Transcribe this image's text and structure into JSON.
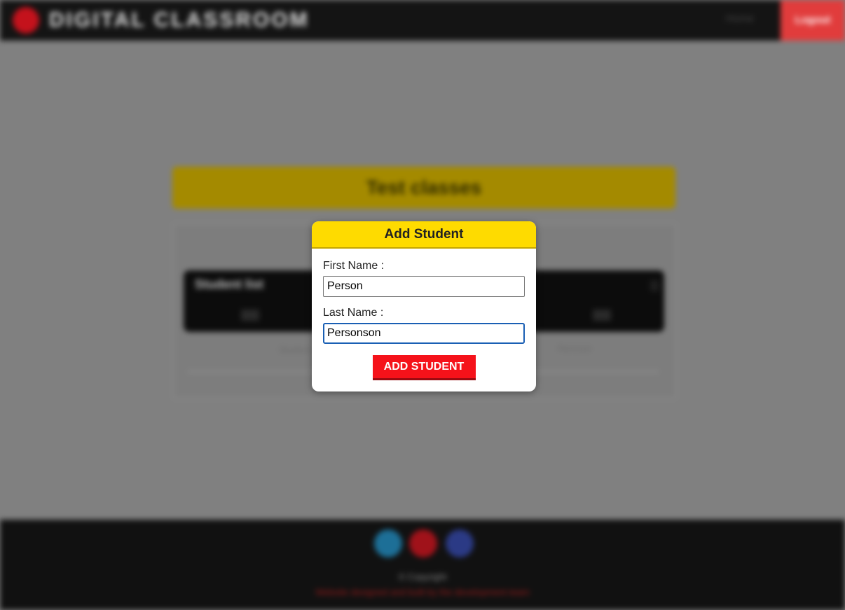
{
  "app": {
    "brand_name": "DIGITAL CLASSROOM",
    "brand_color": "#c4121c",
    "nav": {
      "link_label": "Home",
      "logout_label": "Logout",
      "logout_color": "#e13c3c"
    }
  },
  "page": {
    "class_title": "Test classes",
    "class_title_color": "#fedb00",
    "roster_heading": "Student list",
    "roster_row_text": "Student name",
    "roster_row_action": "Remove"
  },
  "footer": {
    "social_icons": [
      "twitter-icon",
      "youtube-icon",
      "facebook-icon"
    ],
    "copyright": "© Copyright",
    "credit": "Website designed and built by the development team"
  },
  "modal": {
    "title": "Add Student",
    "header_color": "#fedb00",
    "first_name": {
      "label": "First Name :",
      "value": "Person"
    },
    "last_name": {
      "label": "Last Name :",
      "value": "Personson"
    },
    "submit_label": "ADD STUDENT",
    "submit_color": "#f5121a"
  }
}
